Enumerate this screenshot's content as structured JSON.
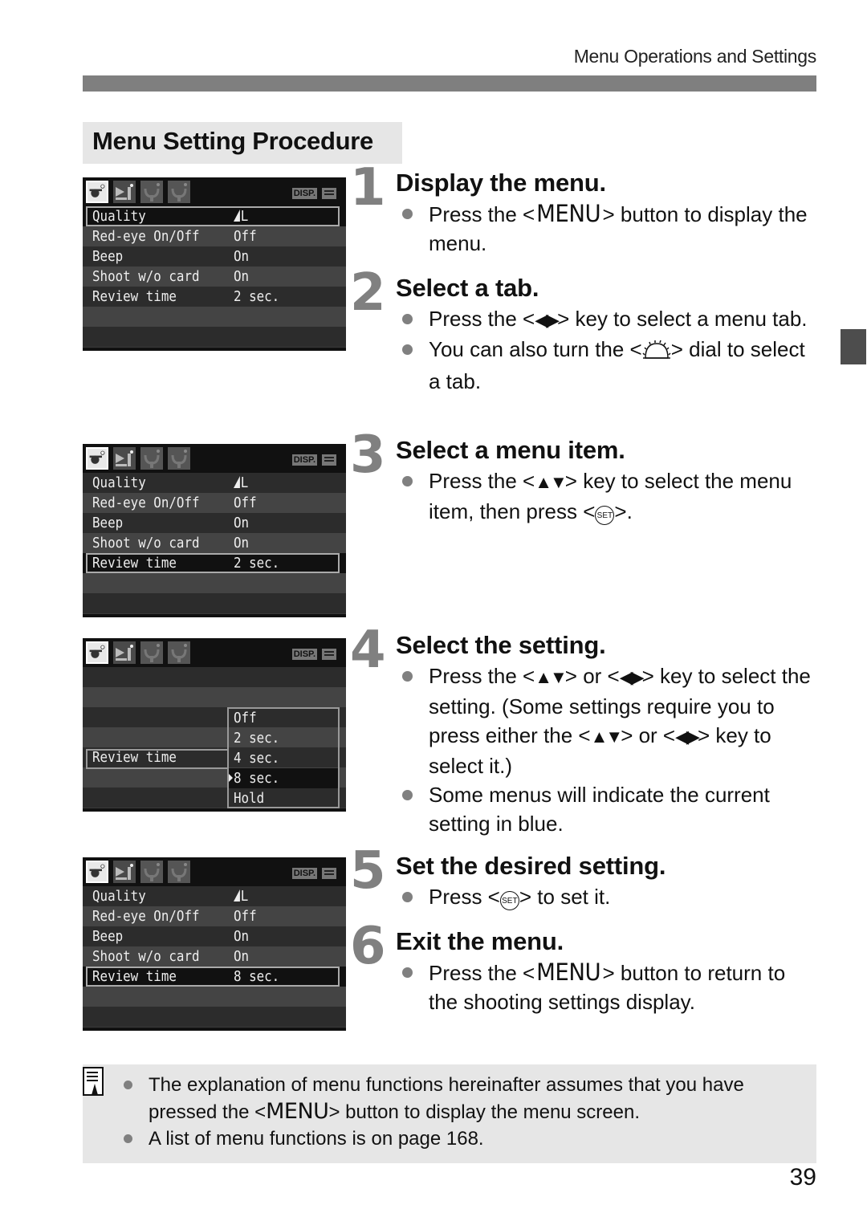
{
  "running_head": "Menu Operations and Settings",
  "section_title": "Menu Setting Procedure",
  "page_number": "39",
  "lcd_common": {
    "disp_label": "DISP.",
    "tabs": [
      "shooting-menu-tab",
      "playback-menu-tab",
      "setup-menu-tab-1",
      "setup-menu-tab-2"
    ],
    "active_tab": 0
  },
  "screens": [
    {
      "rows": [
        {
          "label": "Quality",
          "value": "L",
          "value_icon": "quality-large-icon"
        },
        {
          "label": "Red-eye On/Off",
          "value": "Off"
        },
        {
          "label": "Beep",
          "value": "On"
        },
        {
          "label": "Shoot w/o card",
          "value": "On"
        },
        {
          "label": "Review time",
          "value": "2 sec."
        }
      ],
      "selected_index": 0
    },
    {
      "rows": [
        {
          "label": "Quality",
          "value": "L",
          "value_icon": "quality-large-icon"
        },
        {
          "label": "Red-eye On/Off",
          "value": "Off"
        },
        {
          "label": "Beep",
          "value": "On"
        },
        {
          "label": "Shoot w/o card",
          "value": "On"
        },
        {
          "label": "Review time",
          "value": "2 sec."
        }
      ],
      "selected_index": 4
    },
    {
      "item_label": "Review time",
      "options": [
        "Off",
        "2 sec.",
        "4 sec.",
        "8 sec.",
        "Hold"
      ],
      "selected_option": 3
    },
    {
      "rows": [
        {
          "label": "Quality",
          "value": "L",
          "value_icon": "quality-large-icon"
        },
        {
          "label": "Red-eye On/Off",
          "value": "Off"
        },
        {
          "label": "Beep",
          "value": "On"
        },
        {
          "label": "Shoot w/o card",
          "value": "On"
        },
        {
          "label": "Review time",
          "value": "8 sec."
        }
      ],
      "selected_index": 4
    }
  ],
  "steps": [
    {
      "number": "1",
      "title": "Display the menu.",
      "bullets": [
        {
          "parts": [
            "Press the <",
            "MENU",
            "> button to display the menu."
          ]
        }
      ]
    },
    {
      "number": "2",
      "title": "Select a tab.",
      "bullets": [
        {
          "parts": [
            "Press the <",
            "◀▶",
            "> key to select a menu tab."
          ]
        },
        {
          "parts": [
            "You can also turn the <",
            "main-dial-icon",
            "> dial to select a tab."
          ]
        }
      ]
    },
    {
      "number": "3",
      "title": "Select a menu item.",
      "bullets": [
        {
          "parts": [
            "Press the <",
            "▲▼",
            "> key to select the menu item, then press <",
            "SET",
            ">."
          ]
        }
      ]
    },
    {
      "number": "4",
      "title": "Select the setting.",
      "bullets": [
        {
          "parts": [
            "Press the <",
            "▲▼",
            "> or <",
            "◀▶",
            "> key to select the setting. (Some settings require you to press either the <",
            "▲▼",
            "> or <",
            "◀▶",
            "> key to select it.)"
          ]
        },
        {
          "parts": [
            "Some menus will indicate the current setting in blue."
          ]
        }
      ]
    },
    {
      "number": "5",
      "title": "Set the desired setting.",
      "bullets": [
        {
          "parts": [
            "Press <",
            "SET",
            "> to set it."
          ]
        }
      ]
    },
    {
      "number": "6",
      "title": "Exit the menu.",
      "bullets": [
        {
          "parts": [
            "Press the <",
            "MENU",
            "> button to return to the shooting settings display."
          ]
        }
      ]
    }
  ],
  "note": {
    "icon": "note-pencil-icon",
    "items": [
      {
        "parts": [
          "The explanation of menu functions hereinafter assumes that you have pressed the <",
          "MENU",
          "> button to display the menu screen."
        ]
      },
      {
        "parts": [
          "A list of menu functions is on page 168."
        ]
      }
    ]
  }
}
